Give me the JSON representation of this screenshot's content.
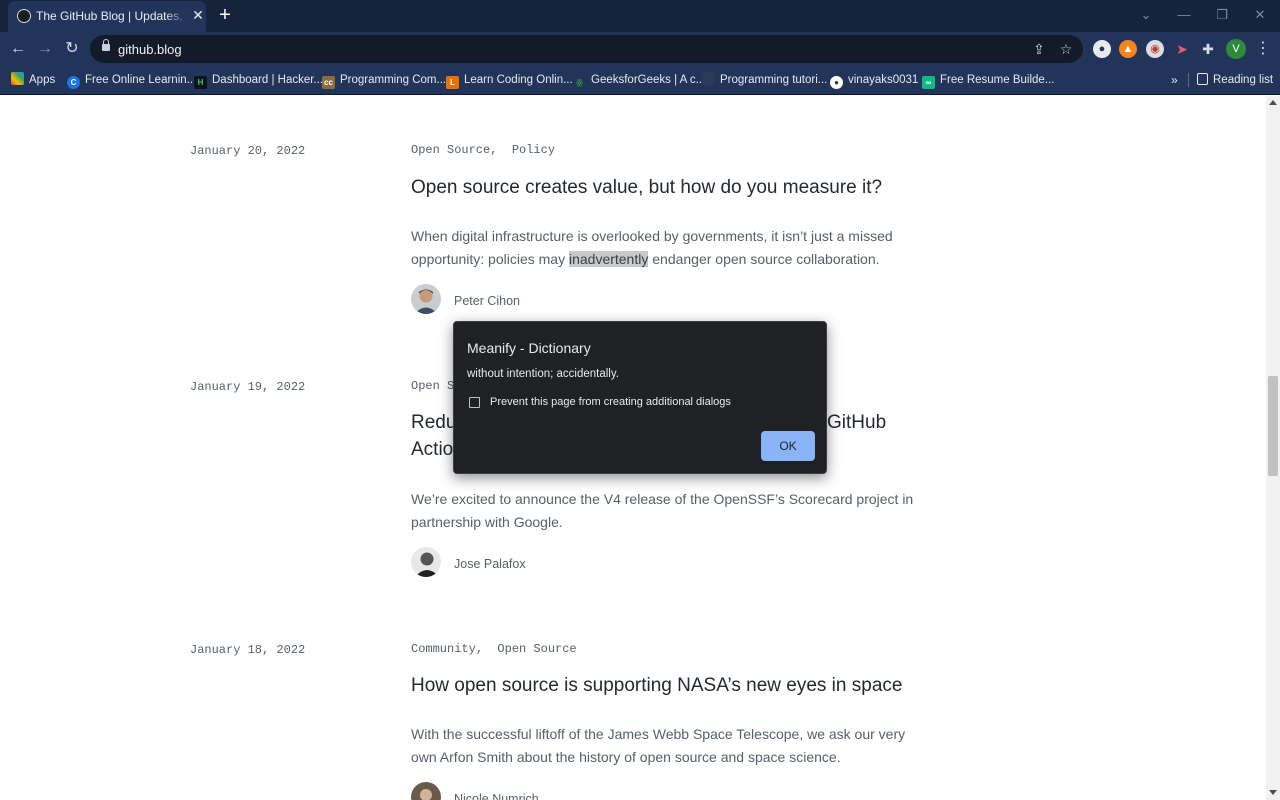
{
  "browser": {
    "tab": {
      "title": "The GitHub Blog | Updates, ideas, and inspiration from GitHub",
      "close": "✕"
    },
    "new_tab": "+",
    "window": {
      "minimize": "—",
      "restore": "❐",
      "close": "✕",
      "tab_search": "⌄"
    },
    "nav": {
      "back": "←",
      "forward": "→",
      "reload": "↻"
    },
    "url": "github.blog",
    "profile_initial": "V",
    "menu": "⋮",
    "bookmarks": [
      {
        "label": "Apps",
        "icon": "apps-grid-icon",
        "color": "#e8710a"
      },
      {
        "label": "Free Online Learnin...",
        "icon": "c-icon",
        "color": "#1a73e8"
      },
      {
        "label": "Dashboard | Hacker...",
        "icon": "hackerrank-icon",
        "color": "#2ec866"
      },
      {
        "label": "Programming Com...",
        "icon": "cc-icon",
        "color": "#8a6d3b"
      },
      {
        "label": "Learn Coding Onlin...",
        "icon": "learn-icon",
        "color": "#e8710a"
      },
      {
        "label": "GeeksforGeeks | A c...",
        "icon": "gfg-icon",
        "color": "#2f8d46"
      },
      {
        "label": "Programming tutori...",
        "icon": "tutorial-icon",
        "color": "#2b3a55"
      },
      {
        "label": "vinayaks0031",
        "icon": "github-icon",
        "color": "#ffffff"
      },
      {
        "label": "Free Resume Builde...",
        "icon": "resume-icon",
        "color": "#10b981"
      }
    ],
    "bookmarks_overflow": "»",
    "reading_list": "Reading list"
  },
  "posts": [
    {
      "date": "January 20, 2022",
      "tags": [
        "Open Source",
        "Policy"
      ],
      "title": "Open source creates value, but how do you measure it?",
      "excerpt_before": "When digital infrastructure is overlooked by governments, it isn’t just a missed opportunity: policies may ",
      "excerpt_highlight": "inadvertently",
      "excerpt_after": " endanger open source collaboration.",
      "author": "Peter Cihon"
    },
    {
      "date": "January 19, 2022",
      "tags": [
        "Open Source"
      ],
      "tags_visible": "Open Sc",
      "title_left": "Reduc",
      "title_left2": "Actio",
      "title_right": "GitHub",
      "excerpt": "We’re excited to announce the V4 release of the OpenSSF’s Scorecard project in partnership with Google.",
      "author": "Jose Palafox"
    },
    {
      "date": "January 18, 2022",
      "tags": [
        "Community",
        "Open Source"
      ],
      "title": "How open source is supporting NASA’s new eyes in space",
      "excerpt": "With the successful liftoff of the James Webb Space Telescope, we ask our very own Arfon Smith about the history of open source and space science.",
      "author": "Nicole Numrich"
    }
  ],
  "dialog": {
    "title": "Meanify - Dictionary",
    "message": "without intention; accidentally.",
    "checkbox_label": "Prevent this page from creating additional dialogs",
    "checkbox_checked": false,
    "ok_label": "OK"
  }
}
